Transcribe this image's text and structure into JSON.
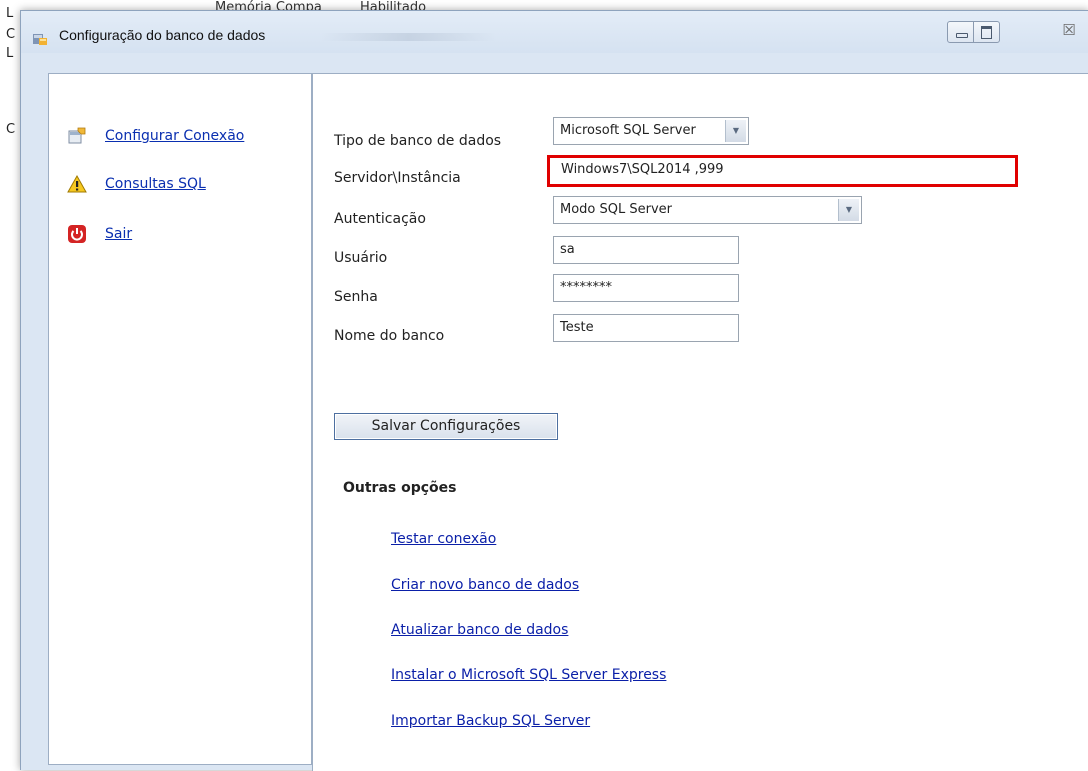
{
  "background": {
    "letters": [
      "L",
      "C",
      "L",
      "C"
    ],
    "top_items": [
      "Memória Compa",
      "Habilitado"
    ]
  },
  "window": {
    "title": "Configuração do banco de dados",
    "controls": {
      "close_glyph": "☒"
    }
  },
  "sidebar": {
    "items": [
      {
        "label": "Configurar Conexão",
        "icon": "configure-connection-icon"
      },
      {
        "label": "Consultas SQL",
        "icon": "warning-icon"
      },
      {
        "label": "Sair",
        "icon": "power-icon"
      }
    ]
  },
  "form": {
    "db_type": {
      "label": "Tipo de banco de dados",
      "value": "Microsoft SQL Server"
    },
    "server": {
      "label": "Servidor\\Instância",
      "value": "Windows7\\SQL2014 ,999"
    },
    "auth": {
      "label": "Autenticação",
      "value": "Modo SQL Server"
    },
    "user": {
      "label": "Usuário",
      "value": "sa"
    },
    "password": {
      "label": "Senha",
      "value": "********"
    },
    "db_name": {
      "label": "Nome do banco",
      "value": "Teste"
    },
    "save_label": "Salvar Configurações"
  },
  "other_options": {
    "title": "Outras opções",
    "links": [
      "Testar conexão",
      "Criar novo banco de dados",
      "Atualizar banco de dados",
      "Instalar o Microsoft SQL Server Express",
      "Importar Backup SQL Server"
    ]
  },
  "colors": {
    "link": "#0a2fb0",
    "highlight": "#e00000",
    "window_bg": "#dbe6f3"
  }
}
